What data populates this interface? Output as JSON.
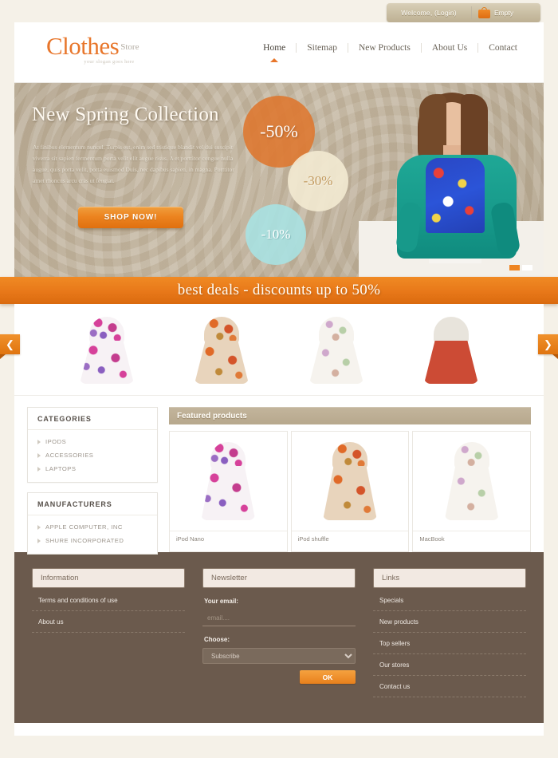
{
  "topbar": {
    "welcome": "Welcome, (Login)",
    "cart_label": "Empty",
    "cart_icon": "shopping-bag-icon"
  },
  "header": {
    "logo_main": "Clothes",
    "logo_sub": "Store",
    "tagline": "your slogan goes here",
    "nav": [
      {
        "label": "Home",
        "active": true
      },
      {
        "label": "Sitemap",
        "active": false
      },
      {
        "label": "New Products",
        "active": false
      },
      {
        "label": "About Us",
        "active": false
      },
      {
        "label": "Contact",
        "active": false
      }
    ]
  },
  "hero": {
    "title": "New Spring Collection",
    "body": "At finibus elementum nuncul. Turpis est, enim sed tristique blandit vel dui suscipit viverra sit sapien fermentum porta velit elit augue risus. A et porttitor congue nulla augue, quis porta velit, porta euismod Duis, nec dapibus sapien, in magna. Porttitor amet rhoncus arcu cras ut feugiat.",
    "cta": "SHOP NOW!",
    "badges": [
      {
        "label": "-50%",
        "color": "#de762e"
      },
      {
        "label": "-30%",
        "color": "#f3ead1"
      },
      {
        "label": "-10%",
        "color": "#a7e2e4"
      }
    ],
    "slides": [
      {
        "active": true
      },
      {
        "active": false
      }
    ]
  },
  "deals": {
    "text": "best deals - discounts up to 50%"
  },
  "carousel": {
    "prev_icon": "chevron-left-icon",
    "next_icon": "chevron-right-icon",
    "items": [
      {
        "name": "strapless-pink-floral-dress"
      },
      {
        "name": "strapless-orange-floral-dress"
      },
      {
        "name": "spaghetti-strap-light-floral-dress"
      },
      {
        "name": "red-pleated-skirt-outfit"
      }
    ]
  },
  "sidebar": {
    "blocks": [
      {
        "title": "CATEGORIES",
        "items": [
          "IPODS",
          "ACCESSORIES",
          "LAPTOPS"
        ]
      },
      {
        "title": "MANUFACTURERS",
        "items": [
          "APPLE COMPUTER, INC",
          "SHURE INCORPORATED"
        ]
      }
    ]
  },
  "main": {
    "title": "Featured products",
    "products": [
      {
        "name": "iPod Nano",
        "style": "p-floral-pink"
      },
      {
        "name": "iPod shuffle",
        "style": "p-floral-orange"
      },
      {
        "name": "MacBook",
        "style": "p-floral-light"
      }
    ]
  },
  "footer": {
    "information": {
      "title": "Information",
      "items": [
        "Terms and conditions of use",
        "About us"
      ]
    },
    "newsletter": {
      "title": "Newsletter",
      "email_label": "Your email:",
      "email_placeholder": "email....",
      "choose_label": "Choose:",
      "select_value": "Subscribe",
      "submit_label": "OK"
    },
    "links": {
      "title": "Links",
      "items": [
        "Specials",
        "New products",
        "Top sellers",
        "Our stores",
        "Contact us"
      ]
    }
  },
  "colors": {
    "accent_orange": "#e8762b",
    "banner_orange": "#e87819",
    "hero_tan": "#b9ab95",
    "footer_brown": "#6b5a4d",
    "title_bar": "#bdae95"
  }
}
